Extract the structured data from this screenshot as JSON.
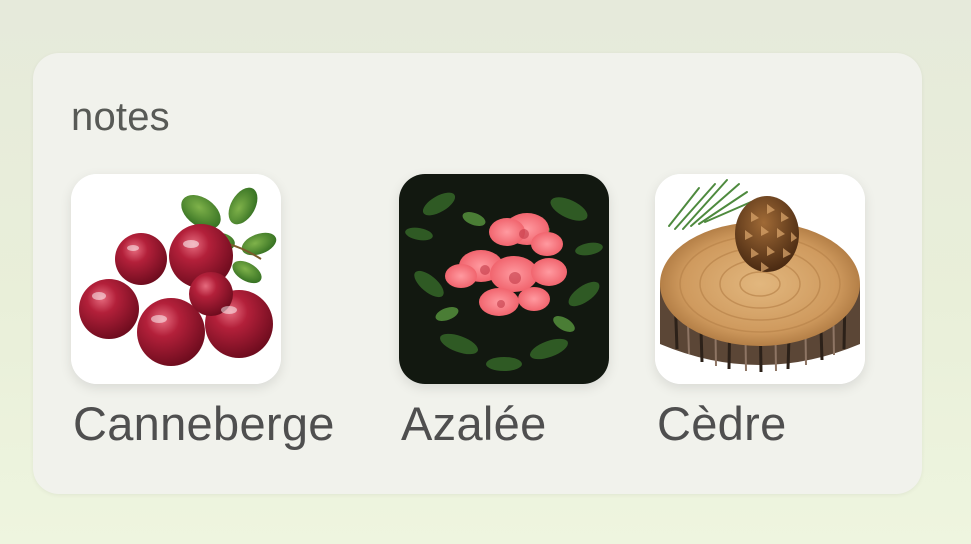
{
  "section": {
    "title": "notes"
  },
  "notes": [
    {
      "label": "Canneberge",
      "image": "cranberry-image"
    },
    {
      "label": "Azalée",
      "image": "azalea-image"
    },
    {
      "label": "Cèdre",
      "image": "cedar-image"
    }
  ],
  "colors": {
    "card_background": "#f1f2ec",
    "text": "#4f4f4f",
    "page_background": "#e9efd9"
  }
}
